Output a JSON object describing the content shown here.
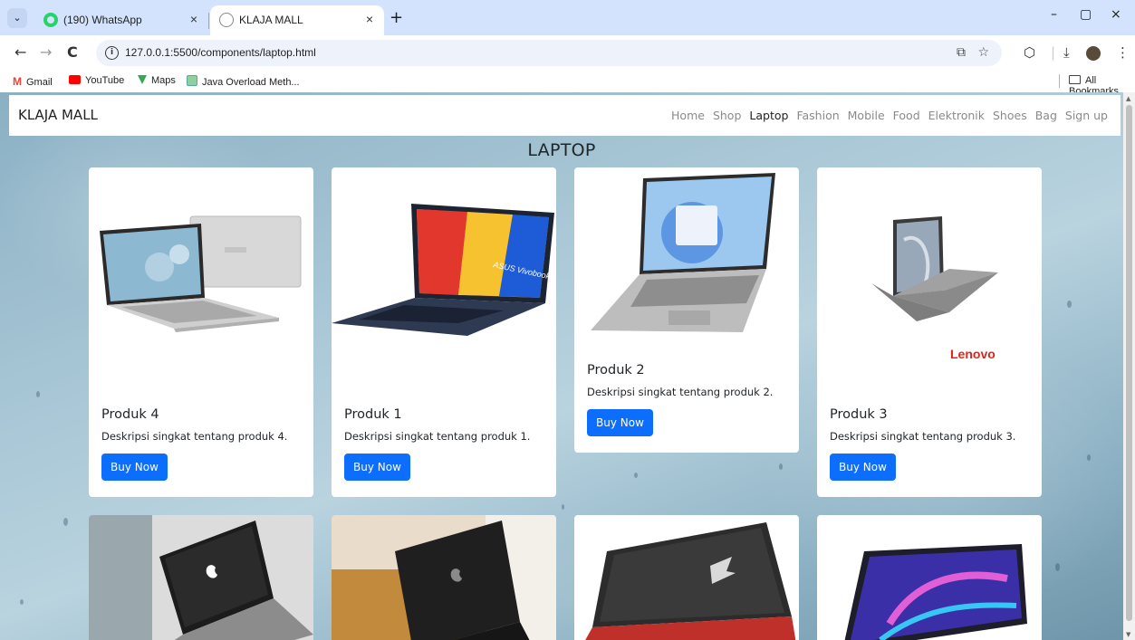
{
  "browser": {
    "tabs": [
      {
        "title": "(190) WhatsApp"
      },
      {
        "title": "KLAJA MALL"
      }
    ],
    "url": "127.0.0.1:5500/components/laptop.html",
    "bookmarks": [
      "Gmail",
      "YouTube",
      "Maps",
      "Java Overload Meth..."
    ],
    "all_bookmarks": "All Bookmarks",
    "glyphs": {
      "close": "×",
      "new_tab": "+",
      "minimize": "–",
      "restore": "▢",
      "back": "←",
      "forward": "→",
      "reload": "C",
      "star": "☆",
      "download": "⤓",
      "more": "⋮",
      "menu": "⌄"
    }
  },
  "site": {
    "brand": "KLAJA MALL",
    "nav": [
      "Home",
      "Shop",
      "Laptop",
      "Fashion",
      "Mobile",
      "Food",
      "Elektronik",
      "Shoes",
      "Bag",
      "Sign up"
    ],
    "active_nav": "Laptop",
    "page_title": "LAPTOP",
    "accent_color": "#0d6efd"
  },
  "products": [
    {
      "title": "Produk 4",
      "desc": "Deskripsi singkat tentang produk 4.",
      "button": "Buy Now"
    },
    {
      "title": "Produk 1",
      "desc": "Deskripsi singkat tentang produk 1.",
      "button": "Buy Now"
    },
    {
      "title": "Produk 2",
      "desc": "Deskripsi singkat tentang produk 2.",
      "button": "Buy Now"
    },
    {
      "title": "Produk 3",
      "desc": "Deskripsi singkat tentang produk 3.",
      "button": "Buy Now"
    }
  ],
  "logo_text": "Lenovo"
}
